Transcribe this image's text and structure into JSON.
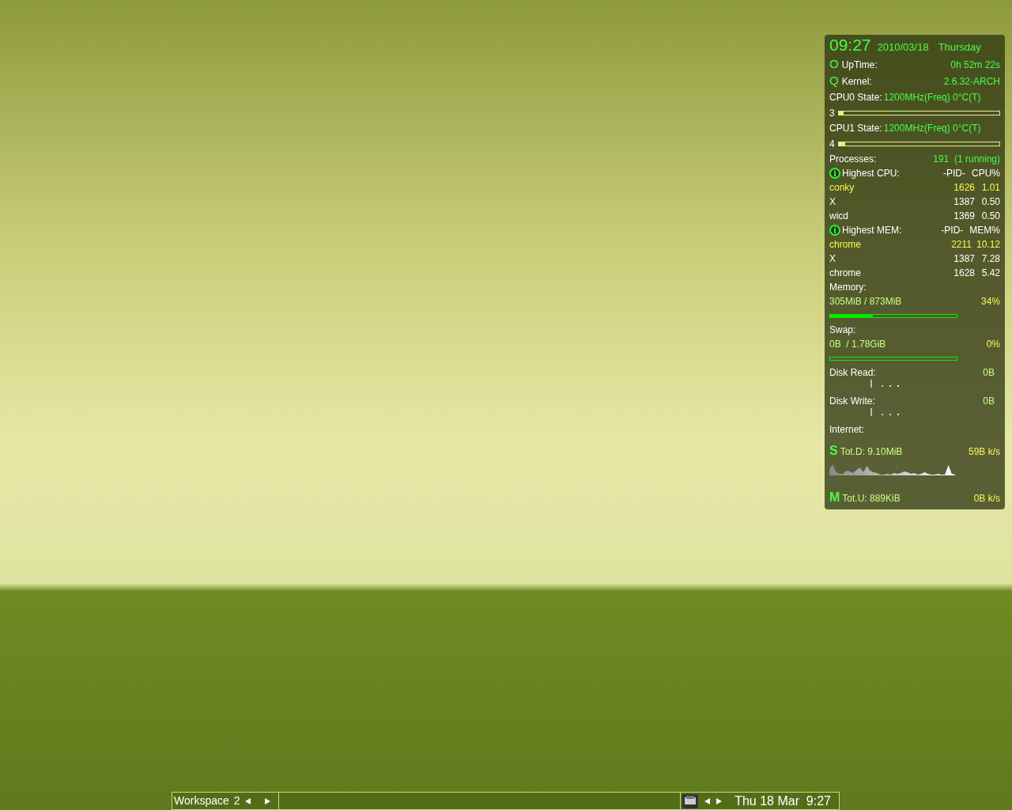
{
  "conky": {
    "clock": {
      "time": "09:27",
      "date": "2010/03/18",
      "day": "Thursday"
    },
    "info_rows": [
      {
        "icon": "O",
        "label": "UpTime:",
        "value": "0h 52m 22s"
      },
      {
        "icon": "Q",
        "label": "Kernel:",
        "value": "2.6.32-ARCH"
      }
    ],
    "cpus": [
      {
        "label": "CPU0 State:",
        "value": "1200MHz(Freq) 0°C(T)",
        "usage": "3",
        "level": 0.03
      },
      {
        "label": "CPU1 State:",
        "value": "1200MHz(Freq) 0°C(T)",
        "usage": "4",
        "level": 0.04
      }
    ],
    "processes": {
      "label": "Processes:",
      "value": "191  (1 running)"
    },
    "top_tables": [
      {
        "icon": "i",
        "title": "Highest CPU:",
        "pid_header": "-PID-",
        "metric_header": "CPU%",
        "rows": [
          {
            "name": "conky",
            "pid": "1626",
            "value": "1.01",
            "highlighted": true
          },
          {
            "name": "X",
            "pid": "1387",
            "value": "0.50",
            "highlighted": false
          },
          {
            "name": "wicd",
            "pid": "1369",
            "value": "0.50",
            "highlighted": false
          }
        ]
      },
      {
        "icon": "i",
        "title": "Highest MEM:",
        "pid_header": "-PID-",
        "metric_header": "MEM%",
        "rows": [
          {
            "name": "chrome",
            "pid": "2211",
            "value": "10.12",
            "highlighted": true
          },
          {
            "name": "X",
            "pid": "1387",
            "value": "7.28",
            "highlighted": false
          },
          {
            "name": "chrome",
            "pid": "1628",
            "value": "5.42",
            "highlighted": false
          }
        ]
      }
    ],
    "meters": [
      {
        "label": "Memory:",
        "usage": "305MiB / 873MiB",
        "percent": "34%",
        "level": 0.34
      },
      {
        "label": "Swap:",
        "usage": "0B  / 1.78GiB",
        "percent": "0%",
        "level": 0
      }
    ],
    "disks": [
      {
        "label": "Disk Read:",
        "value": "0B"
      },
      {
        "label": "Disk Write:",
        "value": "0B"
      }
    ],
    "internet": {
      "label": "Internet:",
      "links": [
        {
          "kind": "down",
          "icon": "S",
          "total": "Tot.D: 9.10MiB",
          "speed": "59B k/s"
        },
        {
          "kind": "up",
          "icon": "M",
          "total": "Tot.U: 889KiB",
          "speed": "0B k/s"
        }
      ]
    }
  },
  "taskbar": {
    "workspace_label": "Workspace",
    "workspace_number": "2",
    "clock": "Thu 18 Mar  9:27"
  }
}
